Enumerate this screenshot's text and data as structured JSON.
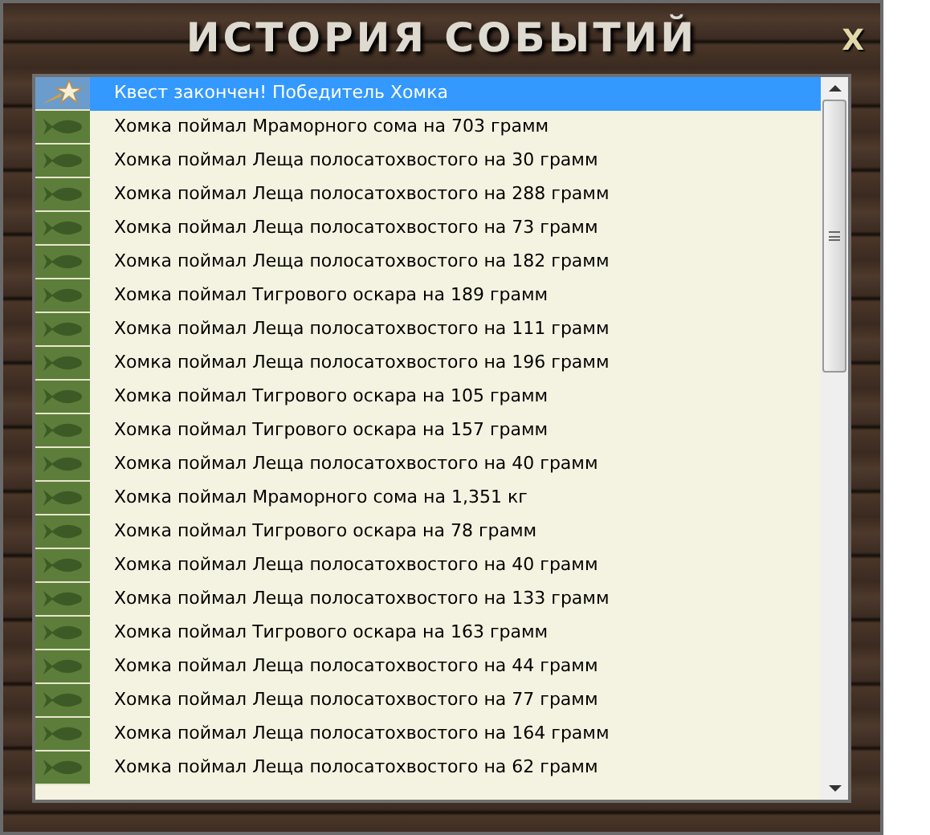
{
  "window": {
    "title": "ИСТОРИЯ СОБЫТИЙ",
    "close": "X"
  },
  "events": [
    {
      "kind": "quest",
      "text": "Квест закончен! Победитель Хомка",
      "selected": true
    },
    {
      "kind": "catch",
      "text": "Хомка поймал Мраморного сома на 703 грамм",
      "selected": false
    },
    {
      "kind": "catch",
      "text": "Хомка поймал Леща полосатохвостого на 30 грамм",
      "selected": false
    },
    {
      "kind": "catch",
      "text": "Хомка поймал Леща полосатохвостого на 288 грамм",
      "selected": false
    },
    {
      "kind": "catch",
      "text": "Хомка поймал Леща полосатохвостого на 73 грамм",
      "selected": false
    },
    {
      "kind": "catch",
      "text": "Хомка поймал Леща полосатохвостого на 182 грамм",
      "selected": false
    },
    {
      "kind": "catch",
      "text": "Хомка поймал Тигрового оскара на 189 грамм",
      "selected": false
    },
    {
      "kind": "catch",
      "text": "Хомка поймал Леща полосатохвостого на 111 грамм",
      "selected": false
    },
    {
      "kind": "catch",
      "text": "Хомка поймал Леща полосатохвостого на 196 грамм",
      "selected": false
    },
    {
      "kind": "catch",
      "text": "Хомка поймал Тигрового оскара на 105 грамм",
      "selected": false
    },
    {
      "kind": "catch",
      "text": "Хомка поймал Тигрового оскара на 157 грамм",
      "selected": false
    },
    {
      "kind": "catch",
      "text": "Хомка поймал Леща полосатохвостого на 40 грамм",
      "selected": false
    },
    {
      "kind": "catch",
      "text": "Хомка поймал Мраморного сома на 1,351 кг",
      "selected": false
    },
    {
      "kind": "catch",
      "text": "Хомка поймал Тигрового оскара на 78 грамм",
      "selected": false
    },
    {
      "kind": "catch",
      "text": "Хомка поймал Леща полосатохвостого на 40 грамм",
      "selected": false
    },
    {
      "kind": "catch",
      "text": "Хомка поймал Леща полосатохвостого на 133 грамм",
      "selected": false
    },
    {
      "kind": "catch",
      "text": "Хомка поймал Тигрового оскара на 163 грамм",
      "selected": false
    },
    {
      "kind": "catch",
      "text": "Хомка поймал Леща полосатохвостого на 44 грамм",
      "selected": false
    },
    {
      "kind": "catch",
      "text": "Хомка поймал Леща полосатохвостого на 77 грамм",
      "selected": false
    },
    {
      "kind": "catch",
      "text": "Хомка поймал Леща полосатохвостого на 164 грамм",
      "selected": false
    },
    {
      "kind": "catch",
      "text": "Хомка поймал Леща полосатохвостого на 62 грамм",
      "selected": false
    }
  ]
}
